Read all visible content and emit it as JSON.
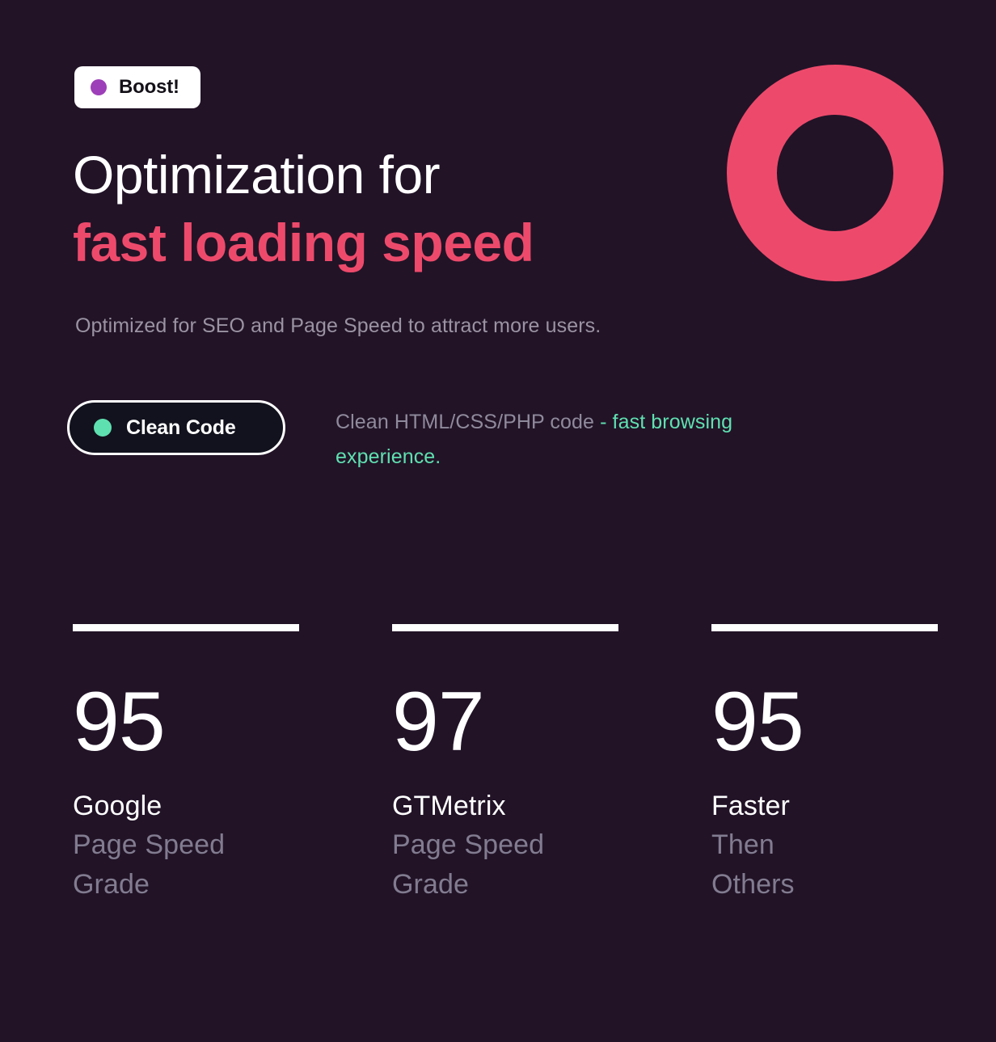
{
  "theme": {
    "background": "#221327",
    "accent_pink": "#ED4A6B",
    "accent_green": "#5FE0B0",
    "accent_purple": "#9D3FB8",
    "text_primary": "#FFFFFF",
    "text_muted": "#8F8A9C"
  },
  "boost_badge": {
    "label": "Boost!",
    "dot_icon": "purple-dot-icon"
  },
  "headline": {
    "line1": "Optimization for",
    "line2": "fast loading speed"
  },
  "subtitle": "Optimized for SEO and Page Speed to attract more users.",
  "clean_code": {
    "badge_label": "Clean Code",
    "dot_icon": "green-dot-icon",
    "description_muted": "Clean HTML/CSS/PHP code ",
    "description_accent": " - fast browsing experience."
  },
  "decoration": {
    "ring_icon": "pink-ring-icon"
  },
  "stats": [
    {
      "value": "95",
      "label_primary": "Google",
      "label_secondary": "Page Speed\nGrade"
    },
    {
      "value": "97",
      "label_primary": "GTMetrix",
      "label_secondary": "Page Speed\nGrade"
    },
    {
      "value": "95",
      "label_primary": "Faster",
      "label_secondary": "Then\nOthers"
    }
  ]
}
